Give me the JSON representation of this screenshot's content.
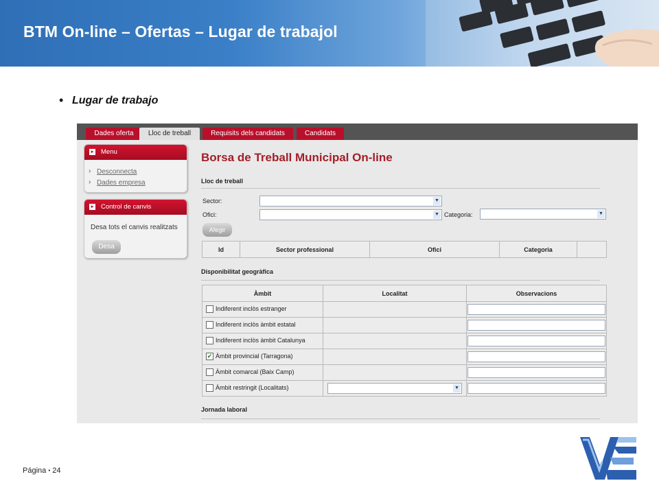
{
  "slide": {
    "title": "BTM On-line – Ofertas – Lugar de trabajol",
    "bullet": "Lugar de trabajo",
    "footer": {
      "label": "Página",
      "separator": "▪",
      "page_number": "24"
    }
  },
  "app": {
    "tabs": [
      {
        "label": "Dades oferta",
        "active": false
      },
      {
        "label": "Lloc de treball",
        "active": true
      },
      {
        "label": "Requisits dels candidats",
        "active": false
      },
      {
        "label": "Candidats",
        "active": false
      }
    ],
    "menu_box": {
      "title": "Menu",
      "links": [
        "Desconnecta",
        "Dades empresa"
      ]
    },
    "control_box": {
      "title": "Control de canvis",
      "text": "Desa tots el canvis realitzats",
      "button": "Desa"
    },
    "main_title": "Borsa de Treball Municipal On-line",
    "lloc": {
      "heading": "Lloc de treball",
      "sector_label": "Sector:",
      "ofici_label": "Ofici:",
      "categoria_label": "Categoria:",
      "sector_value": "",
      "ofici_value": "",
      "categoria_value": "",
      "add_button": "Afegir",
      "columns": [
        "Id",
        "Sector professional",
        "Ofici",
        "Categoria",
        ""
      ]
    },
    "geo": {
      "heading": "Disponibilitat geogràfica",
      "columns": [
        "Àmbit",
        "Localitat",
        "Observacions"
      ],
      "rows": [
        {
          "label": "Indiferent inclòs estranger",
          "checked": false,
          "has_localitat": false
        },
        {
          "label": "Indiferent inclòs àmbit estatal",
          "checked": false,
          "has_localitat": false
        },
        {
          "label": "Indiferent inclòs àmbit Catalunya",
          "checked": false,
          "has_localitat": false
        },
        {
          "label": "Àmbit provincial (Tarragona)",
          "checked": true,
          "has_localitat": false
        },
        {
          "label": "Àmbit comarcal (Baix Camp)",
          "checked": false,
          "has_localitat": false
        },
        {
          "label": "Àmbit restringit (Localitats)",
          "checked": false,
          "has_localitat": true
        }
      ]
    },
    "jornada_heading": "Jornada laboral"
  },
  "colors": {
    "accent_red": "#b8102b",
    "title_red": "#a41e28",
    "header_blue": "#2f6fb6"
  },
  "icons": [
    "chevron-right-icon",
    "checkbox-icon",
    "dropdown-arrow-icon",
    "menu-square-icon",
    "keyboard-photo",
    "company-logo"
  ]
}
